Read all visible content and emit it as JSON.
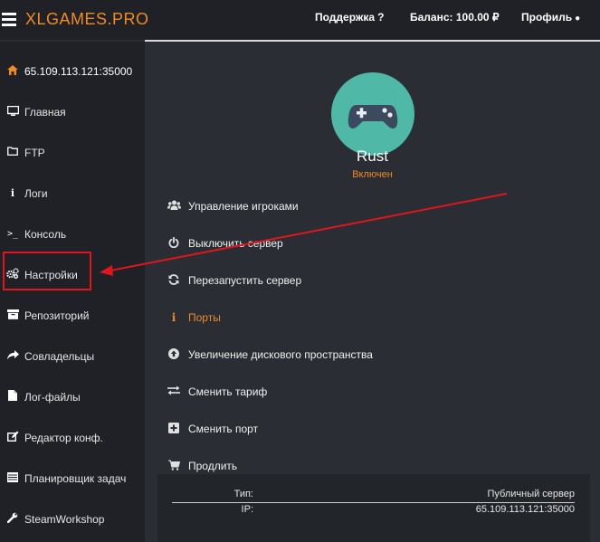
{
  "header": {
    "brand": "XLGAMES.PRO",
    "support_label": "Поддержка",
    "support_icon": "?",
    "balance_label": "Баланс: 100.00 ₽",
    "profile_label": "Профиль",
    "profile_icon": "👤"
  },
  "sidebar": {
    "items": [
      {
        "label": "65.109.113.121:35000",
        "icon": "home-icon"
      },
      {
        "label": "Главная",
        "icon": "monitor-icon"
      },
      {
        "label": "FTP",
        "icon": "folder-icon"
      },
      {
        "label": "Логи",
        "icon": "info-icon"
      },
      {
        "label": "Консоль",
        "icon": "terminal-icon"
      },
      {
        "label": "Настройки",
        "icon": "gears-icon"
      },
      {
        "label": "Репозиторий",
        "icon": "archive-icon"
      },
      {
        "label": "Совладельцы",
        "icon": "share-icon"
      },
      {
        "label": "Лог-файлы",
        "icon": "file-icon"
      },
      {
        "label": "Редактор конф.",
        "icon": "edit-icon"
      },
      {
        "label": "Планировщик задач",
        "icon": "list-icon"
      },
      {
        "label": "SteamWorkshop",
        "icon": "wrench-icon"
      }
    ]
  },
  "game": {
    "title": "Rust",
    "status": "Включен"
  },
  "actions": [
    {
      "label": "Управление игроками",
      "icon": "users-icon"
    },
    {
      "label": "Выключить сервер",
      "icon": "power-icon"
    },
    {
      "label": "Перезапустить сервер",
      "icon": "refresh-icon"
    },
    {
      "label": "Порты",
      "icon": "info-icon"
    },
    {
      "label": "Увеличение дискового пространства",
      "icon": "arrow-up-circle-icon"
    },
    {
      "label": "Сменить тариф",
      "icon": "exchange-icon"
    },
    {
      "label": "Сменить порт",
      "icon": "plus-square-icon"
    },
    {
      "label": "Продлить",
      "icon": "cart-icon"
    }
  ],
  "server_info": {
    "type_label": "Тип:",
    "type_value": "Публичный сервер",
    "ip_label": "IP:",
    "ip_value": "65.109.113.121:35000"
  },
  "colors": {
    "accent": "#f08a24",
    "background": "#2a2d33",
    "sidebar": "#1f2126",
    "avatar": "#4fb8a7",
    "annotation": "#e0161e"
  }
}
